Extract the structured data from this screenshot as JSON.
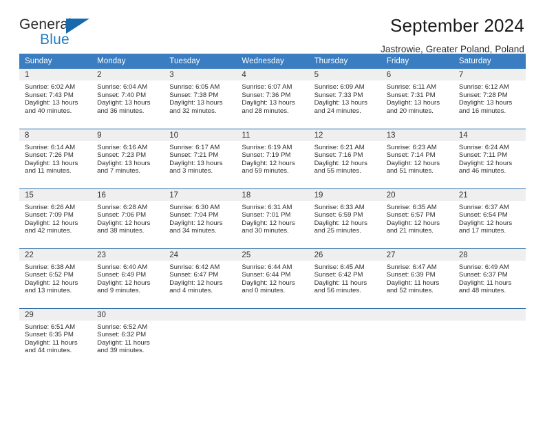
{
  "brand": {
    "name_part1": "General",
    "name_part2": "Blue",
    "accent_color": "#1769ad"
  },
  "header": {
    "title": "September 2024",
    "subtitle": "Jastrowie, Greater Poland, Poland"
  },
  "calendar": {
    "header_bg": "#3a7dc0",
    "daynum_bg": "#efefef",
    "weekday_headers": [
      "Sunday",
      "Monday",
      "Tuesday",
      "Wednesday",
      "Thursday",
      "Friday",
      "Saturday"
    ],
    "weeks": [
      [
        {
          "day": "1",
          "sunrise": "Sunrise: 6:02 AM",
          "sunset": "Sunset: 7:43 PM",
          "daylight1": "Daylight: 13 hours",
          "daylight2": "and 40 minutes."
        },
        {
          "day": "2",
          "sunrise": "Sunrise: 6:04 AM",
          "sunset": "Sunset: 7:40 PM",
          "daylight1": "Daylight: 13 hours",
          "daylight2": "and 36 minutes."
        },
        {
          "day": "3",
          "sunrise": "Sunrise: 6:05 AM",
          "sunset": "Sunset: 7:38 PM",
          "daylight1": "Daylight: 13 hours",
          "daylight2": "and 32 minutes."
        },
        {
          "day": "4",
          "sunrise": "Sunrise: 6:07 AM",
          "sunset": "Sunset: 7:36 PM",
          "daylight1": "Daylight: 13 hours",
          "daylight2": "and 28 minutes."
        },
        {
          "day": "5",
          "sunrise": "Sunrise: 6:09 AM",
          "sunset": "Sunset: 7:33 PM",
          "daylight1": "Daylight: 13 hours",
          "daylight2": "and 24 minutes."
        },
        {
          "day": "6",
          "sunrise": "Sunrise: 6:11 AM",
          "sunset": "Sunset: 7:31 PM",
          "daylight1": "Daylight: 13 hours",
          "daylight2": "and 20 minutes."
        },
        {
          "day": "7",
          "sunrise": "Sunrise: 6:12 AM",
          "sunset": "Sunset: 7:28 PM",
          "daylight1": "Daylight: 13 hours",
          "daylight2": "and 16 minutes."
        }
      ],
      [
        {
          "day": "8",
          "sunrise": "Sunrise: 6:14 AM",
          "sunset": "Sunset: 7:26 PM",
          "daylight1": "Daylight: 13 hours",
          "daylight2": "and 11 minutes."
        },
        {
          "day": "9",
          "sunrise": "Sunrise: 6:16 AM",
          "sunset": "Sunset: 7:23 PM",
          "daylight1": "Daylight: 13 hours",
          "daylight2": "and 7 minutes."
        },
        {
          "day": "10",
          "sunrise": "Sunrise: 6:17 AM",
          "sunset": "Sunset: 7:21 PM",
          "daylight1": "Daylight: 13 hours",
          "daylight2": "and 3 minutes."
        },
        {
          "day": "11",
          "sunrise": "Sunrise: 6:19 AM",
          "sunset": "Sunset: 7:19 PM",
          "daylight1": "Daylight: 12 hours",
          "daylight2": "and 59 minutes."
        },
        {
          "day": "12",
          "sunrise": "Sunrise: 6:21 AM",
          "sunset": "Sunset: 7:16 PM",
          "daylight1": "Daylight: 12 hours",
          "daylight2": "and 55 minutes."
        },
        {
          "day": "13",
          "sunrise": "Sunrise: 6:23 AM",
          "sunset": "Sunset: 7:14 PM",
          "daylight1": "Daylight: 12 hours",
          "daylight2": "and 51 minutes."
        },
        {
          "day": "14",
          "sunrise": "Sunrise: 6:24 AM",
          "sunset": "Sunset: 7:11 PM",
          "daylight1": "Daylight: 12 hours",
          "daylight2": "and 46 minutes."
        }
      ],
      [
        {
          "day": "15",
          "sunrise": "Sunrise: 6:26 AM",
          "sunset": "Sunset: 7:09 PM",
          "daylight1": "Daylight: 12 hours",
          "daylight2": "and 42 minutes."
        },
        {
          "day": "16",
          "sunrise": "Sunrise: 6:28 AM",
          "sunset": "Sunset: 7:06 PM",
          "daylight1": "Daylight: 12 hours",
          "daylight2": "and 38 minutes."
        },
        {
          "day": "17",
          "sunrise": "Sunrise: 6:30 AM",
          "sunset": "Sunset: 7:04 PM",
          "daylight1": "Daylight: 12 hours",
          "daylight2": "and 34 minutes."
        },
        {
          "day": "18",
          "sunrise": "Sunrise: 6:31 AM",
          "sunset": "Sunset: 7:01 PM",
          "daylight1": "Daylight: 12 hours",
          "daylight2": "and 30 minutes."
        },
        {
          "day": "19",
          "sunrise": "Sunrise: 6:33 AM",
          "sunset": "Sunset: 6:59 PM",
          "daylight1": "Daylight: 12 hours",
          "daylight2": "and 25 minutes."
        },
        {
          "day": "20",
          "sunrise": "Sunrise: 6:35 AM",
          "sunset": "Sunset: 6:57 PM",
          "daylight1": "Daylight: 12 hours",
          "daylight2": "and 21 minutes."
        },
        {
          "day": "21",
          "sunrise": "Sunrise: 6:37 AM",
          "sunset": "Sunset: 6:54 PM",
          "daylight1": "Daylight: 12 hours",
          "daylight2": "and 17 minutes."
        }
      ],
      [
        {
          "day": "22",
          "sunrise": "Sunrise: 6:38 AM",
          "sunset": "Sunset: 6:52 PM",
          "daylight1": "Daylight: 12 hours",
          "daylight2": "and 13 minutes."
        },
        {
          "day": "23",
          "sunrise": "Sunrise: 6:40 AM",
          "sunset": "Sunset: 6:49 PM",
          "daylight1": "Daylight: 12 hours",
          "daylight2": "and 9 minutes."
        },
        {
          "day": "24",
          "sunrise": "Sunrise: 6:42 AM",
          "sunset": "Sunset: 6:47 PM",
          "daylight1": "Daylight: 12 hours",
          "daylight2": "and 4 minutes."
        },
        {
          "day": "25",
          "sunrise": "Sunrise: 6:44 AM",
          "sunset": "Sunset: 6:44 PM",
          "daylight1": "Daylight: 12 hours",
          "daylight2": "and 0 minutes."
        },
        {
          "day": "26",
          "sunrise": "Sunrise: 6:45 AM",
          "sunset": "Sunset: 6:42 PM",
          "daylight1": "Daylight: 11 hours",
          "daylight2": "and 56 minutes."
        },
        {
          "day": "27",
          "sunrise": "Sunrise: 6:47 AM",
          "sunset": "Sunset: 6:39 PM",
          "daylight1": "Daylight: 11 hours",
          "daylight2": "and 52 minutes."
        },
        {
          "day": "28",
          "sunrise": "Sunrise: 6:49 AM",
          "sunset": "Sunset: 6:37 PM",
          "daylight1": "Daylight: 11 hours",
          "daylight2": "and 48 minutes."
        }
      ],
      [
        {
          "day": "29",
          "sunrise": "Sunrise: 6:51 AM",
          "sunset": "Sunset: 6:35 PM",
          "daylight1": "Daylight: 11 hours",
          "daylight2": "and 44 minutes."
        },
        {
          "day": "30",
          "sunrise": "Sunrise: 6:52 AM",
          "sunset": "Sunset: 6:32 PM",
          "daylight1": "Daylight: 11 hours",
          "daylight2": "and 39 minutes."
        },
        {
          "day": "",
          "sunrise": "",
          "sunset": "",
          "daylight1": "",
          "daylight2": ""
        },
        {
          "day": "",
          "sunrise": "",
          "sunset": "",
          "daylight1": "",
          "daylight2": ""
        },
        {
          "day": "",
          "sunrise": "",
          "sunset": "",
          "daylight1": "",
          "daylight2": ""
        },
        {
          "day": "",
          "sunrise": "",
          "sunset": "",
          "daylight1": "",
          "daylight2": ""
        },
        {
          "day": "",
          "sunrise": "",
          "sunset": "",
          "daylight1": "",
          "daylight2": ""
        }
      ]
    ]
  }
}
